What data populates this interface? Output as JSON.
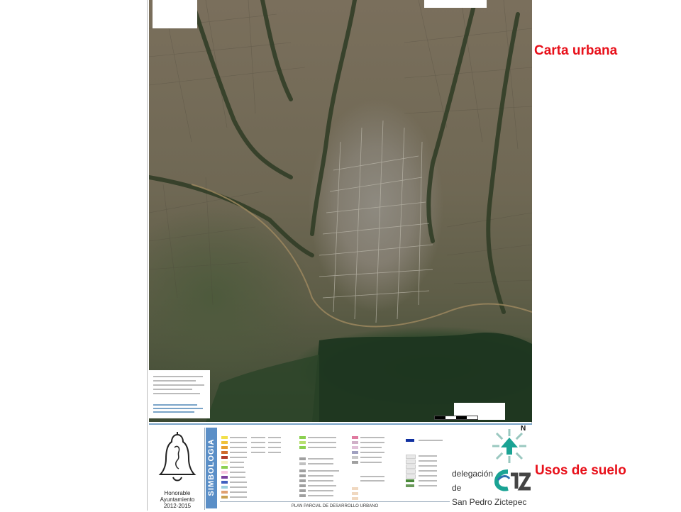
{
  "labels": {
    "carta_urbana": "Carta urbana",
    "usos_de_suelo": "Usos de suelo"
  },
  "legend": {
    "simbologia": "SIMBOLOGIA",
    "plan_title": "PLAN PARCIAL DE DESARROLLO URBANO",
    "council": [
      "Honorable",
      "Ayuntamiento",
      "2012-2015"
    ],
    "delegacion": "delegación",
    "de": "de",
    "municipality": "San Pedro Zictepec",
    "north": "N"
  },
  "colors": {
    "accent_red": "#e8101a",
    "simbologia_blue": "#5b8fc7",
    "north_teal": "#1aa394",
    "swatches": [
      "#f2e04a",
      "#f0c23a",
      "#e8a030",
      "#d06a2a",
      "#b03a2a",
      "#f4f0c0",
      "#8bd050",
      "#f7c8e0",
      "#7b3fa0",
      "#4060c0",
      "#9acfe0",
      "#a0a0a0",
      "#e0a070",
      "#c8a050"
    ]
  },
  "icons": [
    "bell-seal-icon",
    "north-arrow-icon",
    "cpz-logo-icon",
    "scale-bar-icon"
  ]
}
